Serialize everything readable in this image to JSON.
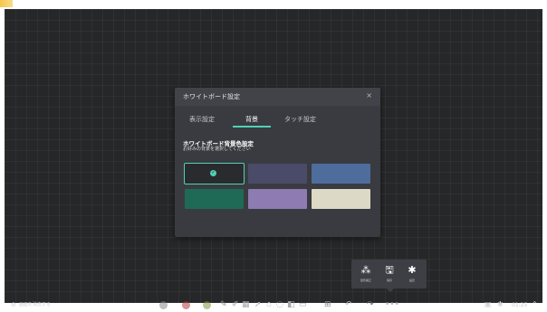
{
  "dialog": {
    "title": "ホワイトボード設定",
    "close": "×",
    "tabs": [
      "表示設定",
      "背景",
      "タッチ設定"
    ],
    "active_tab": "背景",
    "section_title": "ホワイトボード背景色設定",
    "section_subtitle": "お好みの背景を選択してください",
    "swatches": [
      {
        "color": "#2a2b2e",
        "selected": true
      },
      {
        "color": "#4a4b68",
        "selected": false
      },
      {
        "color": "#4f6d9c",
        "selected": false
      },
      {
        "color": "#1f6a56",
        "selected": false
      },
      {
        "color": "#8e7bb1",
        "selected": false
      },
      {
        "color": "#dcd9c6",
        "selected": false
      }
    ],
    "accent": "#4fd1b7"
  },
  "popup": {
    "items": [
      {
        "icon": "shapes-icon",
        "glyph": "⁂",
        "label": "図形補正"
      },
      {
        "icon": "save-icon",
        "glyph": "🖫",
        "label": "保存"
      },
      {
        "icon": "gear-icon",
        "glyph": "✱",
        "label": "設定"
      }
    ]
  },
  "toolbar": {
    "left_label": "画面を消去する",
    "color_dots": [
      "#8a8a8a",
      "#b23a3a",
      "#7c9a3c"
    ],
    "clock": "01:25"
  }
}
